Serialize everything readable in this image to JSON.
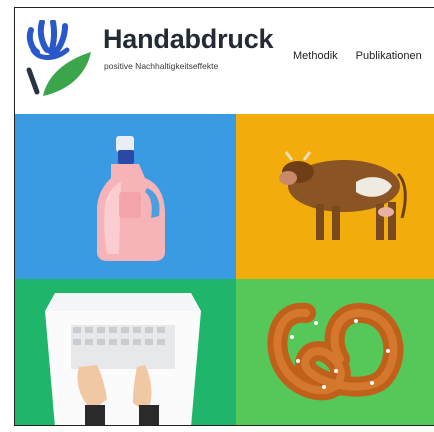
{
  "brand": {
    "name": "Handabdruck",
    "tagline": "positive Nachhaltigkeitseffekte",
    "colors": {
      "blue": "#2a57c9",
      "green": "#3aa54a",
      "text": "#232b36"
    }
  },
  "nav": {
    "items": [
      {
        "label": "Methodik"
      },
      {
        "label": "Publikationen"
      }
    ]
  },
  "tiles": [
    {
      "icon": "detergent-bottle-image",
      "bg": "#3a9be3"
    },
    {
      "icon": "cow-image",
      "bg": "#f2ad0c"
    },
    {
      "icon": "laptop-typing-image",
      "bg": "#1fb56a"
    },
    {
      "icon": "pretzel-image",
      "bg": "#56c85a"
    }
  ]
}
